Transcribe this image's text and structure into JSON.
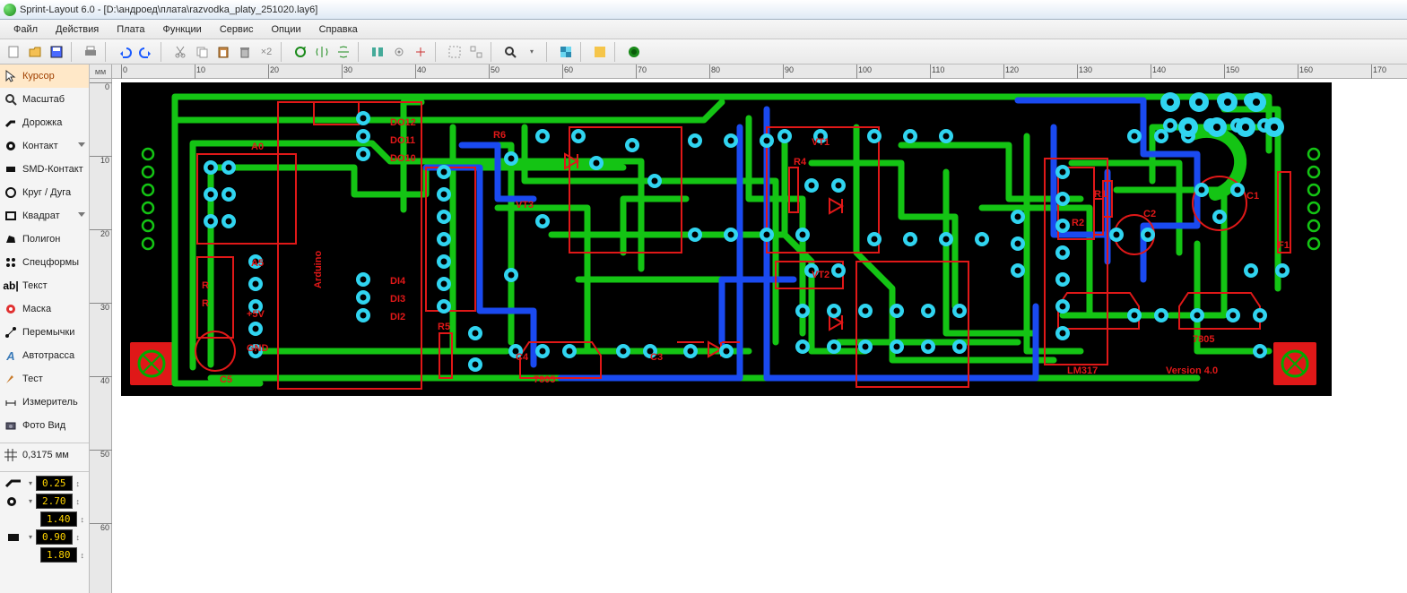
{
  "app": {
    "title": "Sprint-Layout 6.0 - [D:\\андроед\\плата\\razvodka_platy_251020.lay6]"
  },
  "menu": {
    "items": [
      "Файл",
      "Действия",
      "Плата",
      "Функции",
      "Сервис",
      "Опции",
      "Справка"
    ]
  },
  "ruler": {
    "unit": "мм"
  },
  "tools": {
    "cursor": "Курсор",
    "zoom": "Масштаб",
    "track": "Дорожка",
    "pad": "Контакт",
    "smd": "SMD-Контакт",
    "circle": "Круг / Дуга",
    "rect": "Квадрат",
    "poly": "Полигон",
    "special": "Спецформы",
    "text": "Текст",
    "mask": "Маска",
    "jumper": "Перемычки",
    "autoroute": "Автотрасса",
    "test": "Тест",
    "measure": "Измеритель",
    "photo": "Фото Вид"
  },
  "grid": {
    "value": "0,3175 мм"
  },
  "params": {
    "track_w": "0.25",
    "pad_out": "2.70",
    "pad_in": "1.40",
    "smd_w": "0.90",
    "smd_h": "1.80"
  },
  "board_labels": {
    "arduino": "Arduino",
    "a0": "A0",
    "a5": "A5",
    "r": "R",
    "p5v": "+5V",
    "gnd": "GND",
    "c5": "C5",
    "do12": "DO12",
    "do11": "DO11",
    "do10": "DO10",
    "di4": "DI4",
    "di3": "DI3",
    "di2": "DI2",
    "r5": "R5",
    "r6": "R6",
    "vt3": "VT3",
    "c4": "C4",
    "c3": "C3",
    "7805a": "7805",
    "7805b": "7805",
    "vt1": "VT1",
    "vt2": "VT2",
    "r4": "R4",
    "r1": "R1",
    "r2": "R2",
    "c1": "C1",
    "c2": "C2",
    "f1": "F1",
    "lm317": "LM317",
    "version": "Version 4.0"
  }
}
